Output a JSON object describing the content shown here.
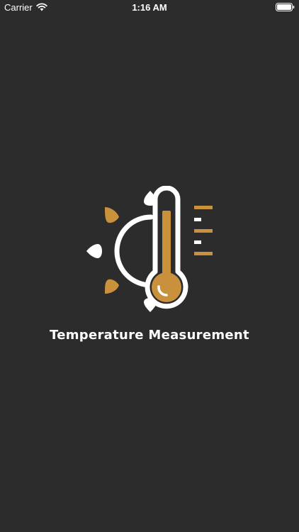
{
  "status_bar": {
    "carrier": "Carrier",
    "time": "1:16 AM",
    "wifi_icon": "wifi-icon",
    "battery_icon": "battery-icon"
  },
  "splash": {
    "logo_icon": "thermometer-sun-icon",
    "title": "Temperature Measurement"
  },
  "colors": {
    "background": "#2d2c2c",
    "accent": "#c9913c",
    "foreground": "#ffffff"
  }
}
